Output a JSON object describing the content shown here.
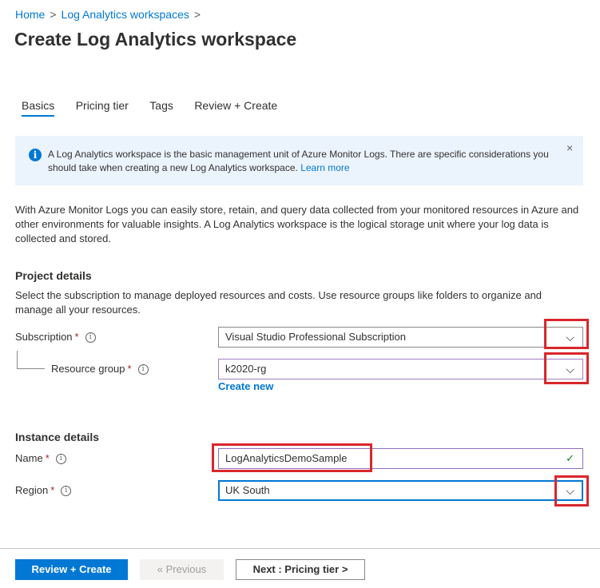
{
  "breadcrumb": {
    "home": "Home",
    "sep1": ">",
    "workspaces": "Log Analytics workspaces",
    "sep2": ">"
  },
  "page_title": "Create Log Analytics workspace",
  "tabs": [
    {
      "label": "Basics",
      "active": true
    },
    {
      "label": "Pricing tier"
    },
    {
      "label": "Tags"
    },
    {
      "label": "Review + Create"
    }
  ],
  "info_bar": {
    "icon": "i",
    "text": "A Log Analytics workspace is the basic management unit of Azure Monitor Logs. There are specific considerations you should take when creating a new Log Analytics workspace.",
    "link": "Learn more",
    "close": "×"
  },
  "intro": "With Azure Monitor Logs you can easily store, retain, and query data collected from your monitored resources in Azure and other environments for valuable insights. A Log Analytics workspace is the logical storage unit where your log data is collected and stored.",
  "project": {
    "title": "Project details",
    "desc": "Select the subscription to manage deployed resources and costs. Use resource groups like folders to organize and manage all your resources.",
    "subscription_label": "Subscription",
    "subscription_value": "Visual Studio Professional Subscription",
    "resource_group_label": "Resource group",
    "resource_group_value": "k2020-rg",
    "create_new": "Create new"
  },
  "instance": {
    "title": "Instance details",
    "name_label": "Name",
    "name_value": "LogAnalyticsDemoSample",
    "region_label": "Region",
    "region_value": "UK South"
  },
  "common": {
    "required": "*",
    "info": "i",
    "chevron": "⌵",
    "check": "✓"
  },
  "footer": {
    "review_create": "Review + Create",
    "previous": "« Previous",
    "next": "Next : Pricing tier >"
  },
  "colors": {
    "accent": "#0078d4",
    "highlight": "#d9262c",
    "info_bg": "#ebf3fc"
  }
}
